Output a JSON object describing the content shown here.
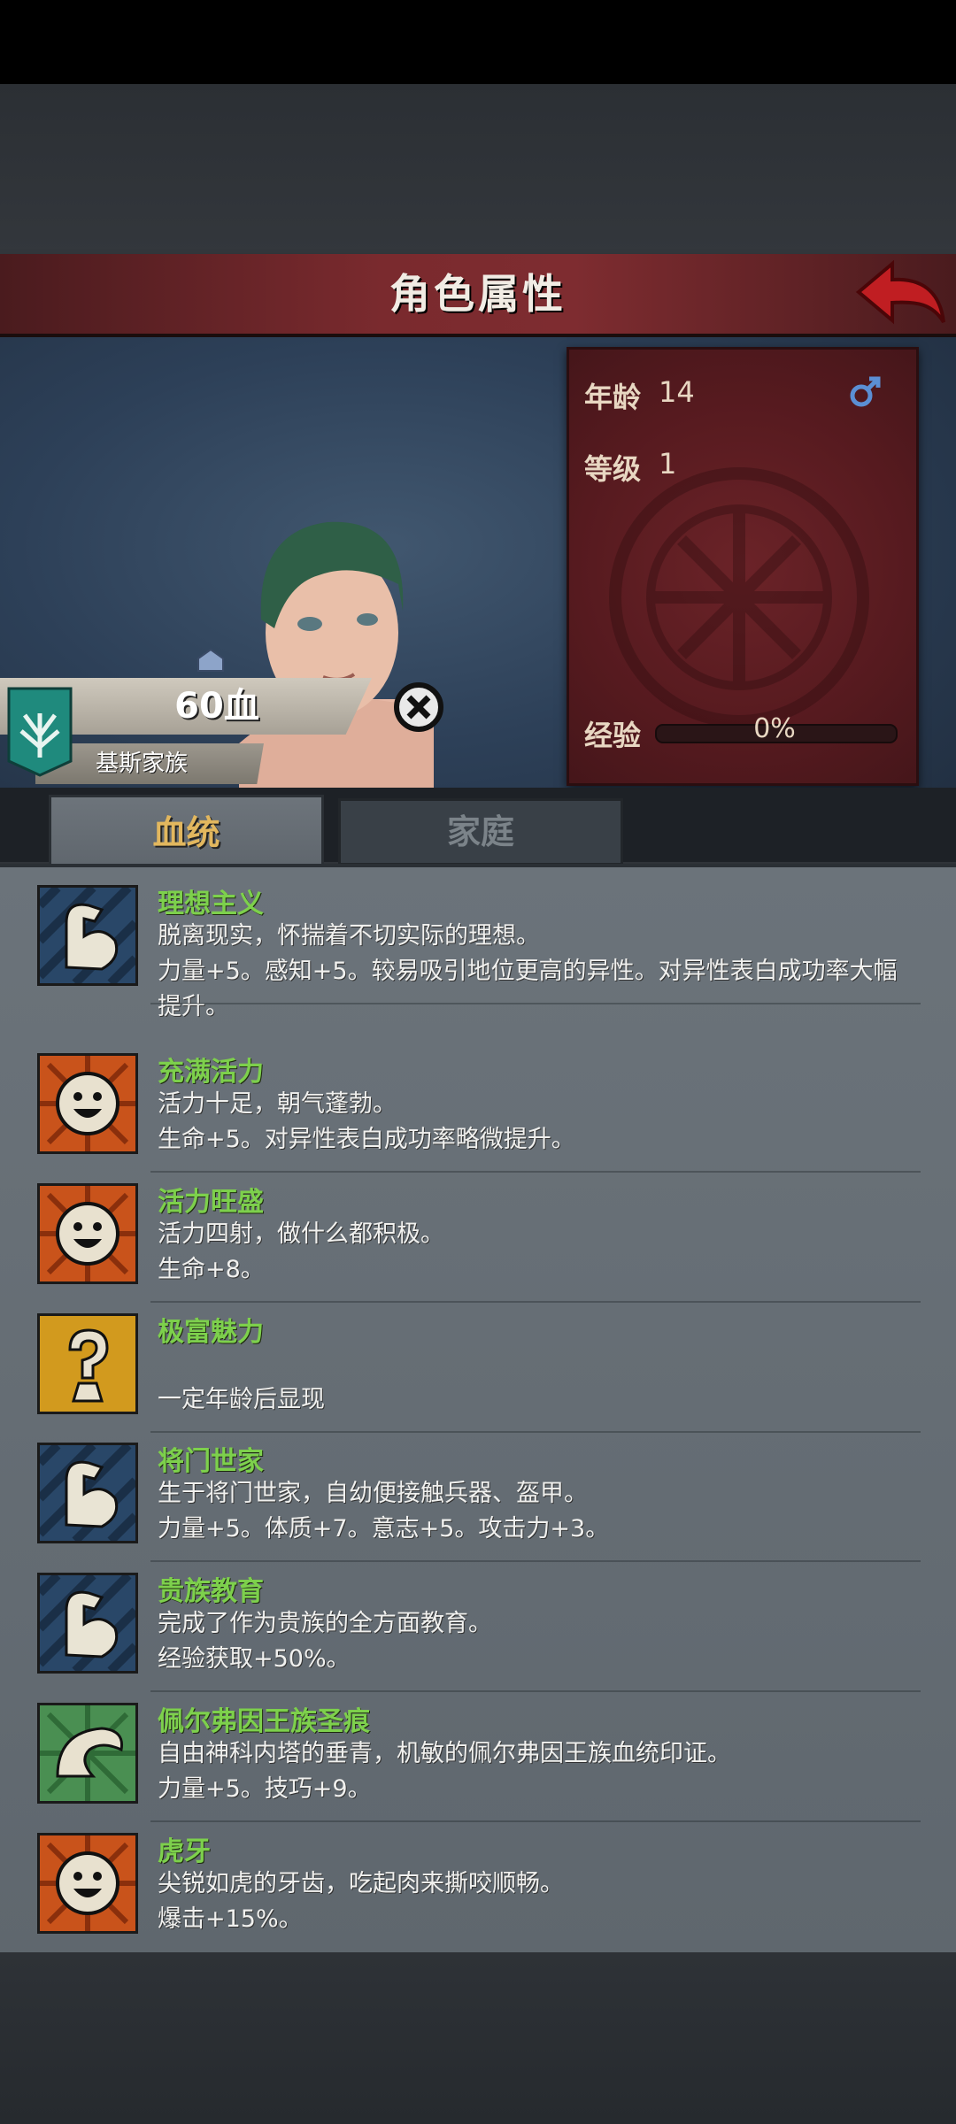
{
  "header": {
    "title": "角色属性"
  },
  "stats": {
    "age_label": "年龄",
    "age_value": "14",
    "level_label": "等级",
    "level_value": "1",
    "exp_label": "经验",
    "exp_value": "0%",
    "exp_fraction": 0,
    "gender": "male"
  },
  "character": {
    "hp_text": "60血",
    "family": "基斯家族"
  },
  "tabs": [
    {
      "label": "血统",
      "active": true
    },
    {
      "label": "家庭",
      "active": false
    }
  ],
  "traits": [
    {
      "name": "理想主义",
      "icon": "flexed-arm-icon",
      "lines": [
        "脱离现实，怀揣着不切实际的理想。",
        "力量+5。感知+5。较易吸引地位更高的异性。对异性表白成功率大幅",
        "提升。"
      ]
    },
    {
      "name": "充满活力",
      "icon": "smiley-sun-icon",
      "lines": [
        "活力十足，朝气蓬勃。",
        "生命+5。对异性表白成功率略微提升。"
      ]
    },
    {
      "name": "活力旺盛",
      "icon": "smiley-sun-icon",
      "lines": [
        "活力四射，做什么都积极。",
        "生命+8。"
      ]
    },
    {
      "name": "极富魅力",
      "icon": "question-icon",
      "lines": [
        "",
        "一定年龄后显现"
      ]
    },
    {
      "name": "将门世家",
      "icon": "flexed-arm-icon",
      "lines": [
        "生于将门世家，自幼便接触兵器、盔甲。",
        "力量+5。体质+7。意志+5。攻击力+3。"
      ]
    },
    {
      "name": "贵族教育",
      "icon": "flexed-arm-icon",
      "lines": [
        "完成了作为贵族的全方面教育。",
        "经验获取+50%。"
      ]
    },
    {
      "name": "佩尔弗因王族圣痕",
      "icon": "swirl-icon",
      "lines": [
        "自由神科内塔的垂青，机敏的佩尔弗因王族血统印证。",
        "力量+5。技巧+9。"
      ]
    },
    {
      "name": "虎牙",
      "icon": "smiley-sun-icon",
      "lines": [
        "尖锐如虎的牙齿，吃起肉来撕咬顺畅。",
        "爆击+15%。"
      ]
    }
  ]
}
